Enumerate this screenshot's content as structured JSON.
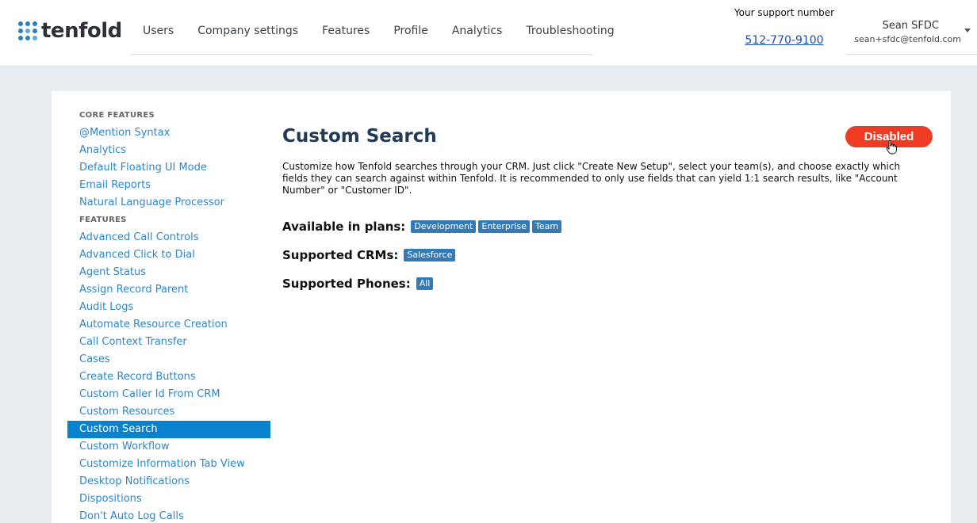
{
  "header": {
    "logo_text": "tenfold",
    "nav": [
      {
        "label": "Users"
      },
      {
        "label": "Company settings"
      },
      {
        "label": "Features"
      },
      {
        "label": "Profile"
      },
      {
        "label": "Analytics"
      },
      {
        "label": "Troubleshooting"
      }
    ],
    "support": {
      "label": "Your support number",
      "phone": "512-770-9100"
    },
    "user": {
      "name": "Sean SFDC",
      "email": "sean+sfdc@tenfold.com"
    }
  },
  "sidebar": {
    "core_heading": "CORE FEATURES",
    "core_items": [
      {
        "label": "@Mention Syntax"
      },
      {
        "label": "Analytics"
      },
      {
        "label": "Default Floating UI Mode"
      },
      {
        "label": "Email Reports"
      },
      {
        "label": "Natural Language Processor"
      }
    ],
    "features_heading": "FEATURES",
    "feature_items": [
      {
        "label": "Advanced Call Controls"
      },
      {
        "label": "Advanced Click to Dial"
      },
      {
        "label": "Agent Status"
      },
      {
        "label": "Assign Record Parent"
      },
      {
        "label": "Audit Logs"
      },
      {
        "label": "Automate Resource Creation"
      },
      {
        "label": "Call Context Transfer"
      },
      {
        "label": "Cases"
      },
      {
        "label": "Create Record Buttons"
      },
      {
        "label": "Custom Caller Id From CRM"
      },
      {
        "label": "Custom Resources"
      },
      {
        "label": "Custom Search"
      },
      {
        "label": "Custom Workflow"
      },
      {
        "label": "Customize Information Tab View"
      },
      {
        "label": "Desktop Notifications"
      },
      {
        "label": "Dispositions"
      },
      {
        "label": "Don't Auto Log Calls"
      }
    ],
    "active_item": "Custom Search"
  },
  "main": {
    "title": "Custom Search",
    "toggle_label": "Disabled",
    "description": "Customize how Tenfold searches through your CRM. Just click \"Create New Setup\", select your team(s), and choose exactly which fields they can search against within Tenfold. It is recommended to only use fields that can yield 1:1 search results, like \"Account Number\" or \"Customer ID\".",
    "plans_label": "Available in plans:",
    "plans": [
      "Development",
      "Enterprise",
      "Team"
    ],
    "crms_label": "Supported CRMs:",
    "crms": [
      "Salesforce"
    ],
    "phones_label": "Supported Phones:",
    "phones": [
      "All"
    ]
  },
  "colors": {
    "accent": "#0a82cd",
    "link": "#2f86c6",
    "tag": "#337ab7",
    "disabled": "#ee3c24"
  }
}
